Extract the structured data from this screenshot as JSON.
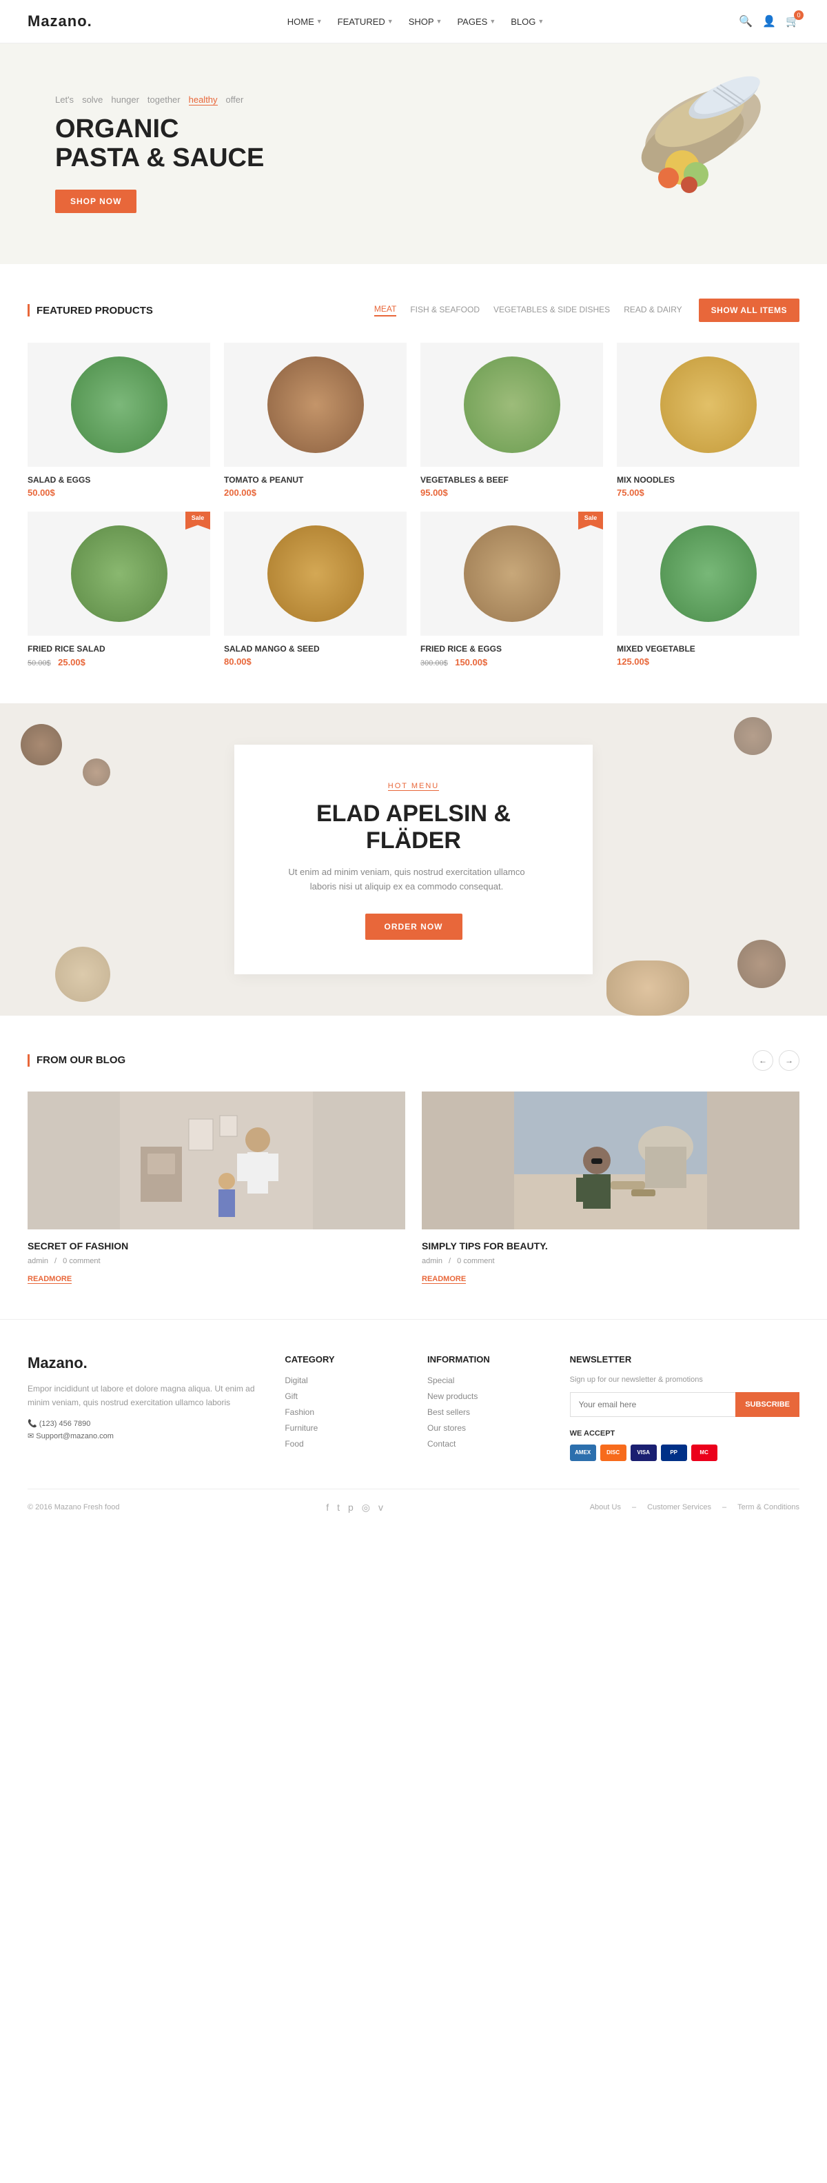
{
  "header": {
    "logo": "Mazano.",
    "nav": [
      {
        "label": "HOME",
        "hasDropdown": true
      },
      {
        "label": "FEATURED",
        "hasDropdown": true
      },
      {
        "label": "SHOP",
        "hasDropdown": true
      },
      {
        "label": "PAGES",
        "hasDropdown": true
      },
      {
        "label": "BLOG",
        "hasDropdown": true
      }
    ],
    "cart_count": "0"
  },
  "hero": {
    "tagline_items": [
      "Let's",
      "solve",
      "hunger",
      "together",
      "healthy",
      "offer"
    ],
    "active_tag": "healthy",
    "title_line1": "ORGANIC",
    "title_line2": "PASTA & SAUCE",
    "cta": "SHOP NOW"
  },
  "featured": {
    "section_title": "FEATURED PRODUCTS",
    "filters": [
      "MEAT",
      "FISH & SEAFOOD",
      "VEGETABLES & SIDE DISHES",
      "READ & DAIRY"
    ],
    "active_filter": "MEAT",
    "show_all_label": "SHOW ALL ITEMS",
    "products": [
      {
        "name": "SALAD & EGGS",
        "price": "50.00$",
        "old_price": "",
        "sale": false,
        "color": "food-green"
      },
      {
        "name": "TOMATO & PEANUT",
        "price": "200.00$",
        "old_price": "",
        "sale": false,
        "color": "food-brown"
      },
      {
        "name": "VEGETABLES & BEEF",
        "price": "95.00$",
        "old_price": "",
        "sale": false,
        "color": "food-mixed"
      },
      {
        "name": "MIX NOODLES",
        "price": "75.00$",
        "old_price": "",
        "sale": false,
        "color": "food-yellow"
      },
      {
        "name": "FRIED RICE SALAD",
        "price": "25.00$",
        "old_price": "50.00$",
        "sale": true,
        "color": "food-avocado"
      },
      {
        "name": "SALAD MANGO & SEED",
        "price": "80.00$",
        "old_price": "",
        "sale": false,
        "color": "food-mango"
      },
      {
        "name": "FRIED RICE & EGGS",
        "price": "150.00$",
        "old_price": "300.00$",
        "sale": true,
        "color": "food-eggs"
      },
      {
        "name": "MIXED VEGETABLE",
        "price": "125.00$",
        "old_price": "",
        "sale": false,
        "color": "food-veggie"
      }
    ]
  },
  "promo": {
    "label": "HOT MENU",
    "title": "ELAD APELSIN & FLÄDER",
    "description": "Ut enim ad minim veniam, quis nostrud exercitation ullamco laboris nisi ut aliquip ex ea commodo consequat.",
    "cta": "ORDER NOW"
  },
  "blog": {
    "section_title": "FROM OUR BLOG",
    "nav_prev": "←",
    "nav_next": "→",
    "posts": [
      {
        "title": "SECRET OF FASHION",
        "meta_author": "admin",
        "meta_comments": "0 comment",
        "readmore": "READMORE",
        "bg": "#d8cfc5"
      },
      {
        "title": "SIMPLY TIPS FOR BEAUTY.",
        "meta_author": "admin",
        "meta_comments": "0 comment",
        "readmore": "READMORE",
        "bg": "#c8bdb0"
      }
    ]
  },
  "footer": {
    "logo": "Mazano.",
    "description": "Empor incididunt ut labore et dolore magna aliqua. Ut enim ad minim veniam, quis nostrud exercitation ullamco laboris",
    "phone": "(123) 456 7890",
    "email": "Support@mazano.com",
    "category": {
      "title": "CATEGORY",
      "links": [
        "Digital",
        "Gift",
        "Fashion",
        "Furniture",
        "Food"
      ]
    },
    "information": {
      "title": "INFORMATION",
      "links": [
        "Special",
        "New products",
        "Best sellers",
        "Our stores",
        "Contact"
      ]
    },
    "newsletter": {
      "title": "NEWSLETTER",
      "desc": "Sign up for our newsletter & promotions",
      "placeholder": "Your email here",
      "subscribe_btn": "SUBSCRIBE",
      "we_accept": "WE ACCEPT",
      "payment_methods": [
        {
          "label": "AMEX",
          "color": "#2c6fad"
        },
        {
          "label": "DISC",
          "color": "#f76b1c"
        },
        {
          "label": "VISA",
          "color": "#1a1f71"
        },
        {
          "label": "PP",
          "color": "#003087"
        },
        {
          "label": "MC",
          "color": "#eb001b"
        }
      ]
    },
    "copyright": "© 2016 Mazano Fresh food",
    "social": [
      "f",
      "t",
      "p",
      "◎",
      "v"
    ],
    "bottom_links": [
      "About Us",
      "Customer Services",
      "Term & Conditions"
    ]
  }
}
